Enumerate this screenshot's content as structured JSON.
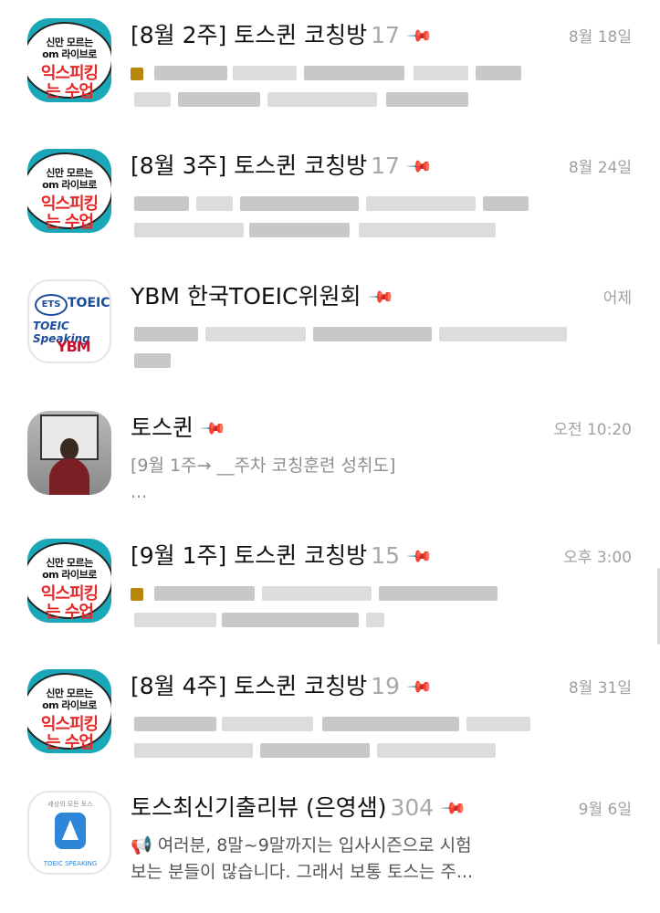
{
  "chats": [
    {
      "title": "[8월 2주] 토스퀸 코칭방",
      "count": "17",
      "time": "8월 18일",
      "avatar": "toeic-class",
      "preview": "",
      "preview2": ""
    },
    {
      "title": "[8월 3주] 토스퀸 코칭방",
      "count": "17",
      "time": "8월 24일",
      "avatar": "toeic-class",
      "preview": "",
      "preview2": ""
    },
    {
      "title": "YBM 한국TOEIC위원회",
      "count": "",
      "time": "어제",
      "avatar": "ets-toeic",
      "preview": "",
      "preview2": ""
    },
    {
      "title": "토스퀸",
      "count": "",
      "time": "오전 10:20",
      "avatar": "photo",
      "preview": "[9월 1주→ __주차 코칭훈련 성취도]",
      "preview2": "..."
    },
    {
      "title": "[9월 1주] 토스퀸 코칭방",
      "count": "15",
      "time": "오후 3:00",
      "avatar": "toeic-class",
      "preview": "",
      "preview2": ""
    },
    {
      "title": "[8월 4주] 토스퀸 코칭방",
      "count": "19",
      "time": "8월 31일",
      "avatar": "toeic-class",
      "preview": "",
      "preview2": ""
    },
    {
      "title": "토스최신기출리뷰 (은영샘)",
      "count": "304",
      "time": "9월 6일",
      "avatar": "app",
      "preview": "📢 여러분, 8말~9말까지는 입사시즌으로 시험",
      "preview2": "보는 분들이 많습니다. 그래서 보통 토스는 주..."
    }
  ],
  "avatar_text": {
    "toeic_line1": "신만 모르는",
    "toeic_line2": "om 라이브로",
    "toeic_line3": "익스피킹",
    "toeic_line4": "는 수업",
    "ets_badge": "ETS",
    "ets_word": "TOEIC",
    "ets_speaking": "TOEIC Speaking",
    "ets_ybm": "YBM",
    "app_top": "세상의 모든 토스",
    "app_bottom": "TOEIC SPEAKING"
  },
  "colors": {
    "teal": "#1aa8b8",
    "red": "#e62828",
    "muted": "#a0a0a0",
    "ybm_red": "#c8102e",
    "ets_blue": "#1a4c9c"
  }
}
